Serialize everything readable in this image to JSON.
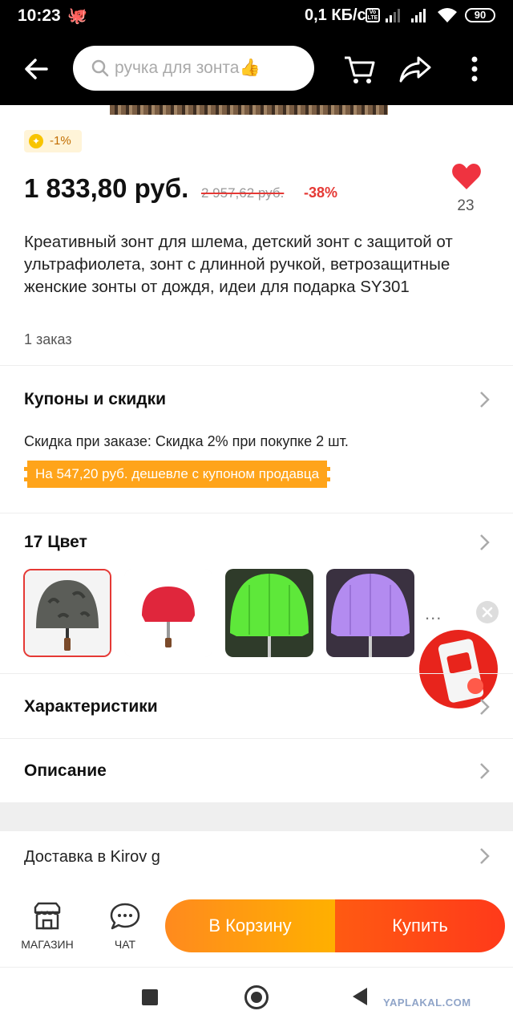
{
  "status_bar": {
    "time": "10:23",
    "net_speed": "0,1 КБ/с",
    "volte": "Vo LTE",
    "battery": "90"
  },
  "header": {
    "search_placeholder": "ручка для зонта👍",
    "icons": [
      "back-arrow-icon",
      "search-icon",
      "cart-icon",
      "share-icon",
      "more-vert-icon"
    ]
  },
  "product": {
    "coins_discount": "-1%",
    "price": "1 833,80 руб.",
    "old_price": "2 957,62 руб.",
    "discount": "-38%",
    "wishlist_count": "23",
    "title": "Креативный зонт для шлема, детский зонт с защитой от ультрафиолета, зонт с длинной ручкой, ветрозащитные женские зонты от дождя, идеи для подарка SY301",
    "orders": "1 заказ"
  },
  "coupons": {
    "title": "Купоны и скидки",
    "order_discount": "Скидка при заказе: Скидка 2% при покупке 2 шт.",
    "seller_coupon": "На 547,20 руб. дешевле с купоном продавца"
  },
  "colors": {
    "title": "17 Цвет",
    "swatches": [
      {
        "name": "Camouflage",
        "canopy": "#5b5d58",
        "selected": true
      },
      {
        "name": "Red",
        "canopy": "#e0263c",
        "selected": false
      },
      {
        "name": "Green",
        "canopy": "#5ee83a",
        "selected": false
      },
      {
        "name": "Purple",
        "canopy": "#b38bf0",
        "selected": false
      }
    ],
    "more": "..."
  },
  "rows": {
    "specs": "Характеристики",
    "description": "Описание",
    "delivery": "Доставка в Kirov g"
  },
  "bottom_bar": {
    "shop_label": "МАГАЗИН",
    "chat_label": "ЧАТ",
    "cart_label": "В Корзину",
    "buy_label": "Купить"
  },
  "watermark": "YAPLAKAL.COM",
  "accent_colors": {
    "red": "#e53935",
    "orange": "#ffa41a",
    "buy": "#ff3a1a"
  }
}
